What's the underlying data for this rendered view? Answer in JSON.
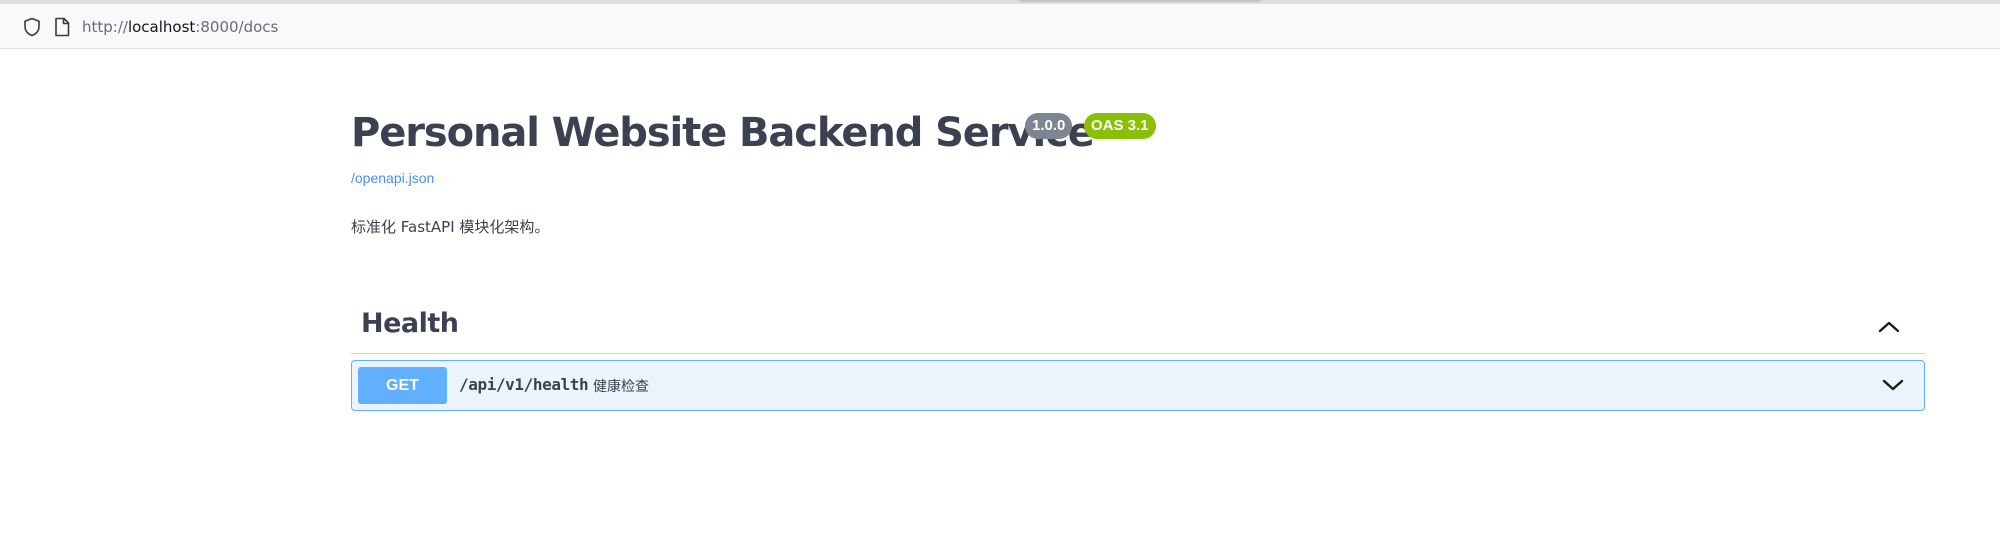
{
  "browser": {
    "url_scheme": "http://",
    "url_host": "localhost",
    "url_rest": ":8000/docs"
  },
  "info": {
    "title": "Personal Website Backend Service",
    "version": "1.0.0",
    "oas_version": "OAS 3.1",
    "spec_link": "/openapi.json",
    "description": "标准化 FastAPI 模块化架构。"
  },
  "tags": [
    {
      "name": "Health",
      "operations": [
        {
          "method": "GET",
          "path": "/api/v1/health",
          "summary": "健康检查"
        }
      ]
    }
  ],
  "colors": {
    "get_method": "#61affe",
    "get_background": "#ebf3fb",
    "version_badge": "#7d8492",
    "oas_badge": "#89bf04",
    "link": "#4990e2",
    "text": "#3b4151"
  },
  "icons": {
    "url_security": "shield-icon",
    "url_page": "page-icon",
    "tag_toggle": "chevron-up-icon",
    "operation_toggle": "chevron-down-icon"
  }
}
